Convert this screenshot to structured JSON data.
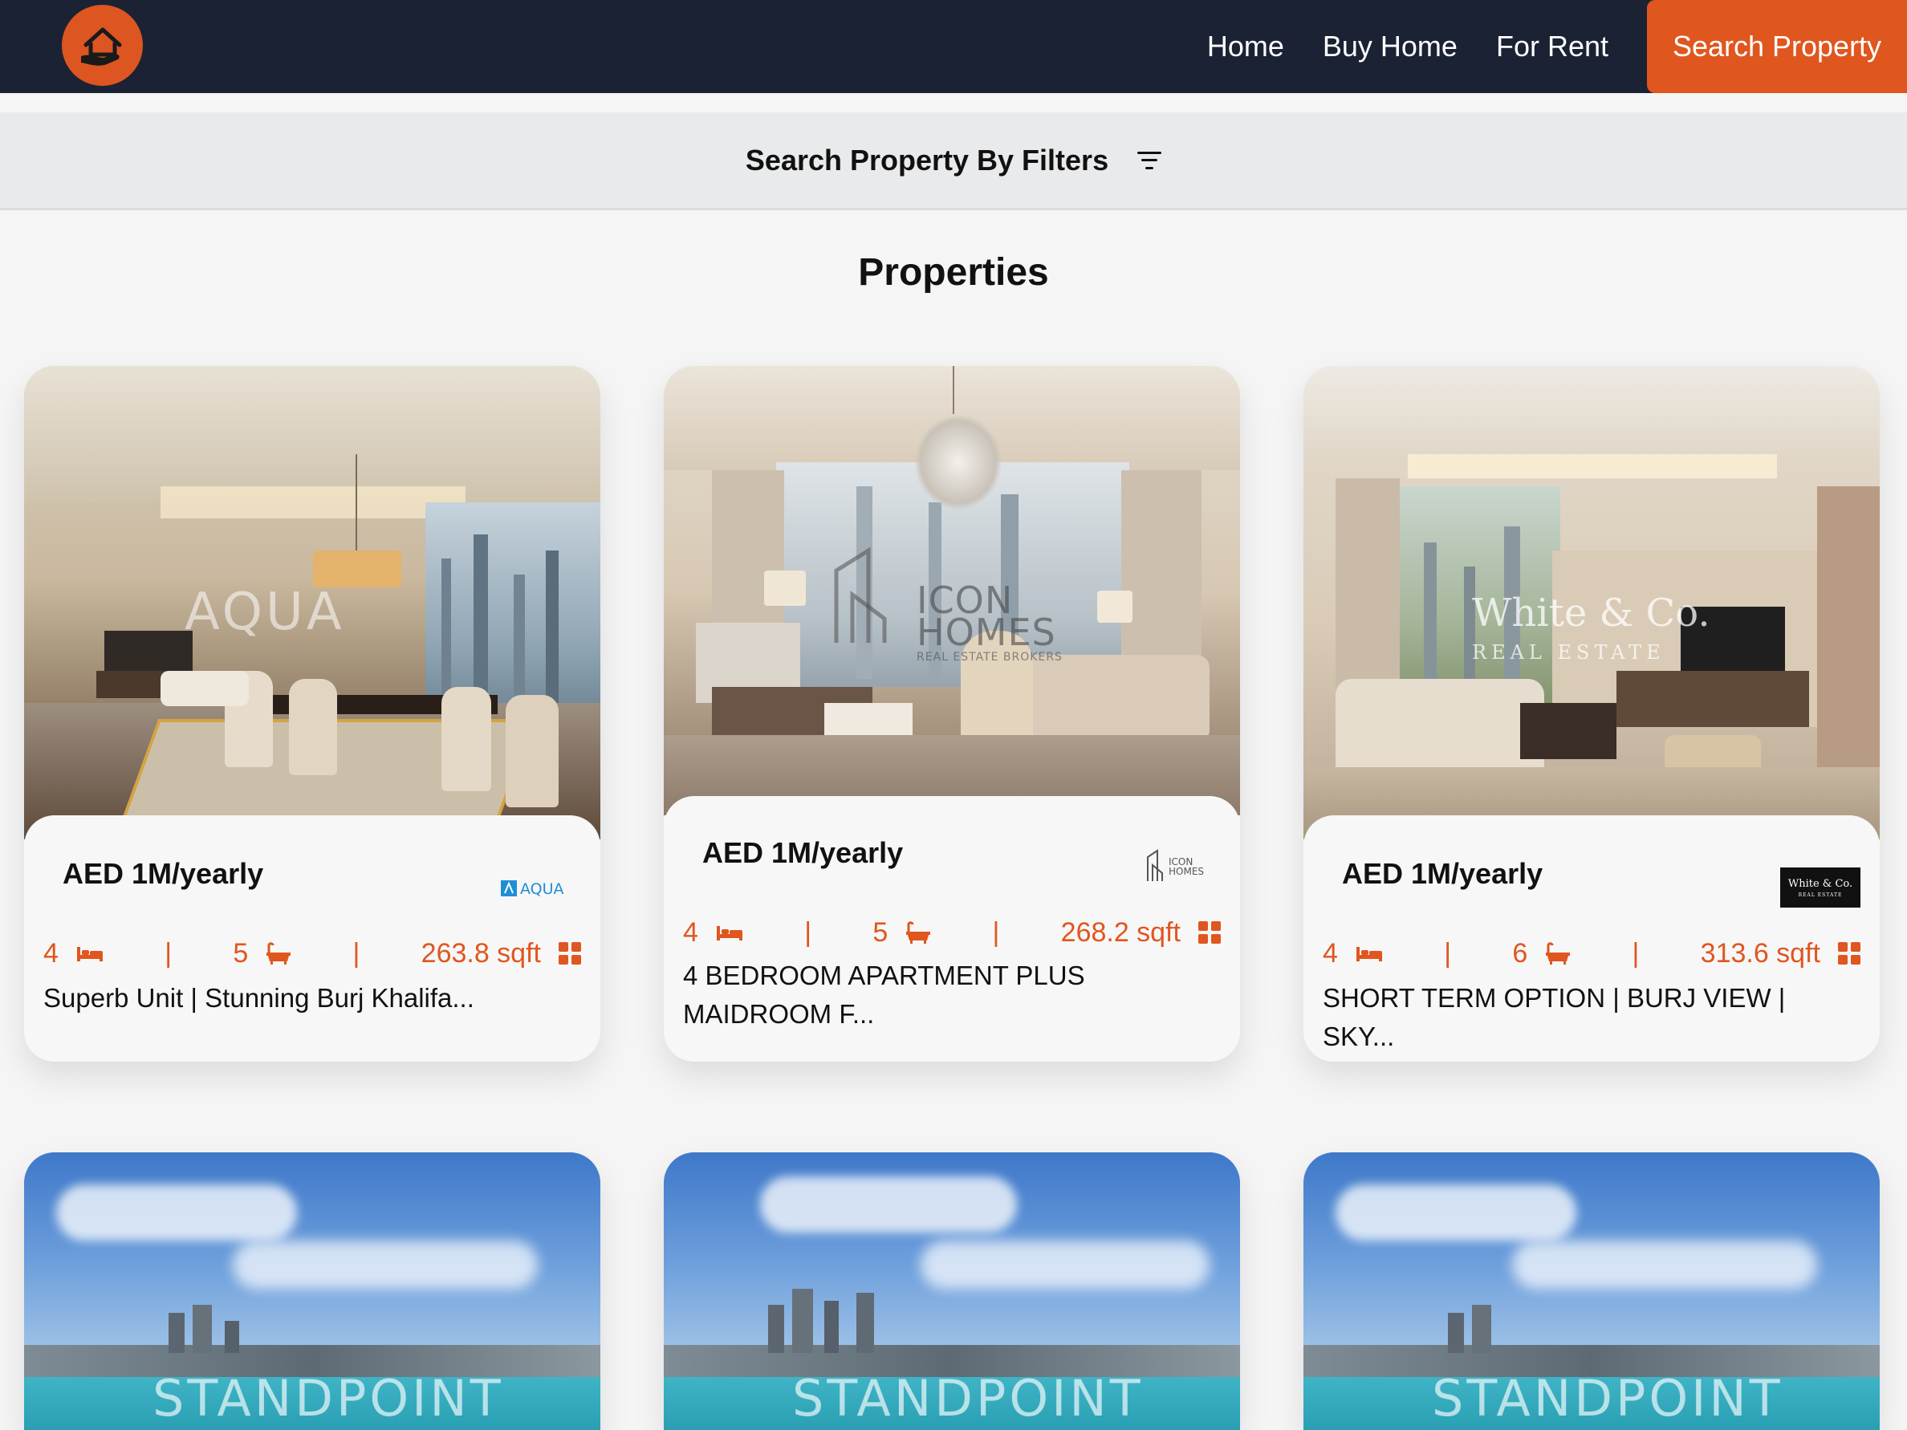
{
  "nav": {
    "links": [
      "Home",
      "Buy Home",
      "For Rent"
    ],
    "cta": "Search Property"
  },
  "filter": {
    "label": "Search Property By Filters"
  },
  "section_title": "Properties",
  "cards": [
    {
      "price": "AED 1M/yearly",
      "agency": "AQUA",
      "beds": "4",
      "baths": "5",
      "area": "263.8 sqft",
      "title": "Superb Unit | Stunning Burj Khalifa..."
    },
    {
      "price": "AED 1M/yearly",
      "agency": "ICON HOMES",
      "beds": "4",
      "baths": "5",
      "area": "268.2 sqft",
      "title": "4 BEDROOM APARTMENT PLUS MAIDROOM F..."
    },
    {
      "price": "AED 1M/yearly",
      "agency": "White & Co.",
      "beds": "4",
      "baths": "6",
      "area": "313.6 sqft",
      "title": "SHORT TERM OPTION | BURJ VIEW | SKY..."
    }
  ],
  "watermarks": {
    "card1": "AQUA",
    "card2_line1": "ICON",
    "card2_line2": "HOMES",
    "card2_line3": "REAL ESTATE BROKERS",
    "card3_line1": "White & Co.",
    "card3_line2": "REAL ESTATE",
    "standpoint": "STANDPOINT"
  },
  "colors": {
    "accent": "#e0561f",
    "nav_bg": "#1a2233"
  },
  "icons": [
    "home-hands-icon",
    "filter-icon",
    "bed-icon",
    "bath-icon",
    "area-icon"
  ]
}
